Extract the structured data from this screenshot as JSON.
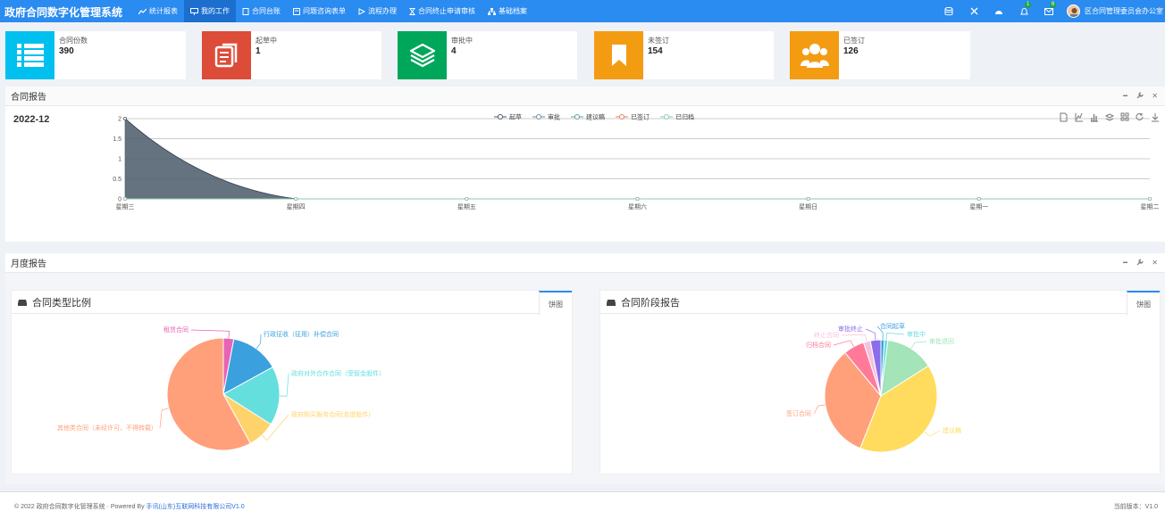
{
  "app": {
    "title": "政府合同数字化管理系统",
    "nav": [
      {
        "label": "统计报表"
      },
      {
        "label": "我的工作"
      },
      {
        "label": "合同台账"
      },
      {
        "label": "问题咨询表单"
      },
      {
        "label": "流程办理"
      },
      {
        "label": "合同终止申请审核"
      },
      {
        "label": "基础档案"
      }
    ],
    "active_nav": 1,
    "badges": {
      "bell": "1",
      "mail": "6"
    },
    "user": "区合同管理委员会办公室",
    "colors": {
      "topbar": "#2a8bf0",
      "active_nav": "#1c6fcf"
    }
  },
  "stats": [
    {
      "label": "合同份数",
      "value": "390",
      "color": "#00c0ef",
      "icon": "list-icon"
    },
    {
      "label": "起草中",
      "value": "1",
      "color": "#dd4b39",
      "icon": "file-stack-icon"
    },
    {
      "label": "审批中",
      "value": "4",
      "color": "#00a65a",
      "icon": "layers-icon"
    },
    {
      "label": "未签订",
      "value": "154",
      "color": "#f39c12",
      "icon": "bookmark-icon"
    },
    {
      "label": "已签订",
      "value": "126",
      "color": "#f39c12",
      "icon": "users-icon"
    }
  ],
  "report": {
    "title": "合同报告",
    "period": "2022-12",
    "legend": [
      "起草",
      "审批",
      "建议稿",
      "已签订",
      "已归档"
    ],
    "chart_data": {
      "type": "area",
      "x": [
        "星期三",
        "星期四",
        "星期五",
        "星期六",
        "星期日",
        "星期一",
        "星期二"
      ],
      "ylim": [
        0,
        2
      ],
      "yticks": [
        "0",
        "0.5",
        "1",
        "1.5",
        "2"
      ],
      "series": [
        {
          "name": "起草",
          "values": [
            2,
            0,
            0,
            0,
            0,
            0,
            0
          ],
          "color": "#4a5b6b"
        },
        {
          "name": "审批",
          "values": [
            0,
            0,
            0,
            0,
            0,
            0,
            0
          ],
          "color": "#6a8fa0"
        },
        {
          "name": "建议稿",
          "values": [
            0,
            0,
            0,
            0,
            0,
            0,
            0
          ],
          "color": "#61a0a8"
        },
        {
          "name": "已签订",
          "values": [
            0,
            0,
            0,
            0,
            0,
            0,
            0
          ],
          "color": "#e08060"
        },
        {
          "name": "已归档",
          "values": [
            0,
            0,
            0,
            0,
            0,
            0,
            0
          ],
          "color": "#91c7ae"
        }
      ],
      "grid": true,
      "legend_position": "top"
    }
  },
  "monthly": {
    "title": "月度报告",
    "type_panel": {
      "title": "合同类型比例",
      "tab": "饼图",
      "chart_data": {
        "type": "pie",
        "slices": [
          {
            "label": "租赁合同",
            "value": 3,
            "color": "#e763b5"
          },
          {
            "label": "行政征收（征用）补偿合同",
            "value": 14,
            "color": "#3ba0de"
          },
          {
            "label": "政府对外合作合同（受智金股件）",
            "value": 17,
            "color": "#65dede"
          },
          {
            "label": "政府购买服务合同(金提股件)",
            "value": 8,
            "color": "#ffd36b"
          },
          {
            "label": "其他类合同（未经许可，不得转载）",
            "value": 58,
            "color": "#ffa07a"
          }
        ]
      }
    },
    "stage_panel": {
      "title": "合同阶段报告",
      "tab": "饼图",
      "chart_data": {
        "type": "pie",
        "slices": [
          {
            "label": "合同起草",
            "value": 1,
            "color": "#3ba0de"
          },
          {
            "label": "审批中",
            "value": 1,
            "color": "#65dede"
          },
          {
            "label": "审批退回",
            "value": 14,
            "color": "#a3e4b8"
          },
          {
            "label": "建议稿",
            "value": 40,
            "color": "#ffdc5e"
          },
          {
            "label": "签订合同",
            "value": 33,
            "color": "#ffa07a"
          },
          {
            "label": "归档合同",
            "value": 6,
            "color": "#ff7a99"
          },
          {
            "label": "终止合同",
            "value": 2,
            "color": "#f7c0e0"
          },
          {
            "label": "审批终止",
            "value": 3,
            "color": "#8a6de8"
          }
        ]
      }
    }
  },
  "footer": {
    "copyright": "© 2022 政府合同数字化管理系统 · Powered By",
    "company": "手讯(山东)互联网科技有限公司V1.0",
    "version": "当前版本：V1.0"
  }
}
